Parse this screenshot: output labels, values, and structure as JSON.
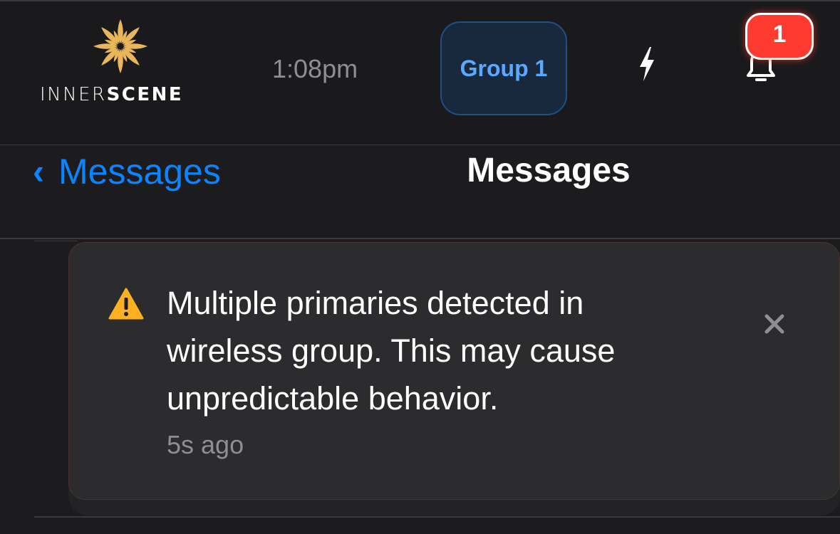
{
  "header": {
    "logo": {
      "icon": "sunburst-logo-icon",
      "text_light": "INNER",
      "text_bold": "SCENE",
      "accent_color": "#e9b75a"
    },
    "time": "1:08pm",
    "group_button": {
      "label": "Group 1",
      "color": "#5aa9ff"
    },
    "power_icon": "lightning-bolt-icon",
    "notifications": {
      "icon": "bell-icon",
      "badge_count": "1",
      "badge_color": "#ff3b30"
    }
  },
  "navbar": {
    "back_label": "Messages",
    "back_icon": "chevron-left-icon",
    "title": "Messages",
    "accent_color": "#0a84ff"
  },
  "messages": [
    {
      "icon": "warning-icon",
      "icon_color": "#ffb020",
      "text": "Multiple primaries detected in wireless group. This may cause unpredictable behavior.",
      "time": "5s ago",
      "dismiss_icon": "close-icon"
    }
  ]
}
